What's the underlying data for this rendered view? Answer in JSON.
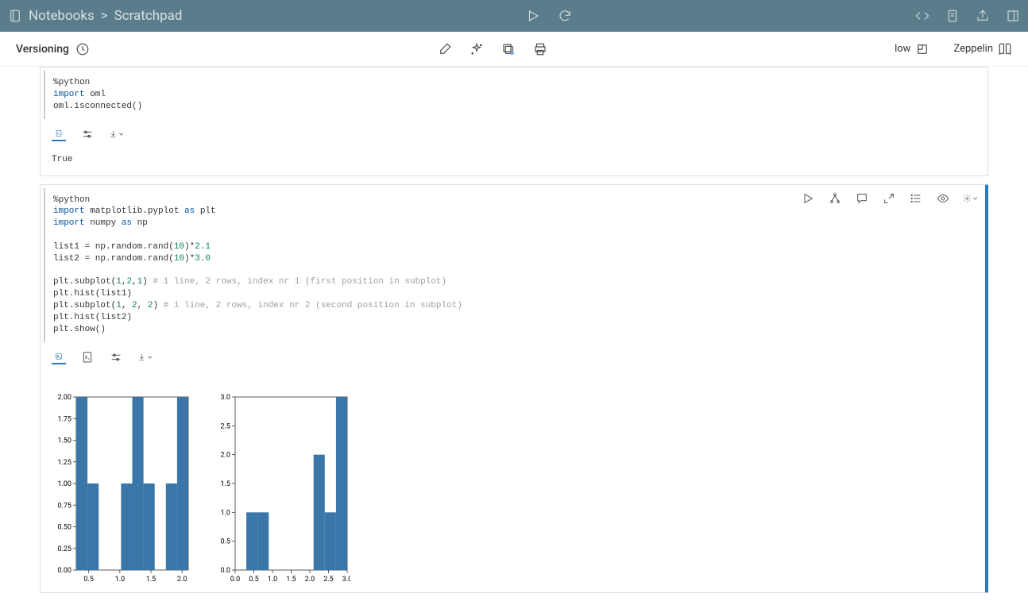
{
  "breadcrumb": {
    "icon": "notebook-icon",
    "part1": "Notebooks",
    "sep": ">",
    "part2": "Scratchpad"
  },
  "subbar": {
    "versioning": "Versioning",
    "low": "low",
    "zeppelin": "Zeppelin"
  },
  "cell1": {
    "code": "%python\nimport oml\noml.isconnected()",
    "code_tokens": [
      {
        "t": "id",
        "s": "%python\n"
      },
      {
        "t": "kw",
        "s": "import"
      },
      {
        "t": "id",
        "s": " oml\noml.isconnected()"
      }
    ],
    "output": "True"
  },
  "cell2": {
    "code_tokens": [
      {
        "t": "id",
        "s": "%python\n"
      },
      {
        "t": "kw",
        "s": "import"
      },
      {
        "t": "id",
        "s": " matplotlib.pyplot "
      },
      {
        "t": "kw",
        "s": "as"
      },
      {
        "t": "id",
        "s": " plt\n"
      },
      {
        "t": "kw",
        "s": "import"
      },
      {
        "t": "id",
        "s": " numpy "
      },
      {
        "t": "kw",
        "s": "as"
      },
      {
        "t": "id",
        "s": " np\n\n"
      },
      {
        "t": "id",
        "s": "list1 = np.random.rand("
      },
      {
        "t": "num",
        "s": "10"
      },
      {
        "t": "id",
        "s": ")*"
      },
      {
        "t": "num",
        "s": "2.1"
      },
      {
        "t": "id",
        "s": "\n"
      },
      {
        "t": "id",
        "s": "list2 = np.random.rand("
      },
      {
        "t": "num",
        "s": "10"
      },
      {
        "t": "id",
        "s": ")*"
      },
      {
        "t": "num",
        "s": "3.0"
      },
      {
        "t": "id",
        "s": "\n\n"
      },
      {
        "t": "id",
        "s": "plt.subplot("
      },
      {
        "t": "num",
        "s": "1"
      },
      {
        "t": "id",
        "s": ","
      },
      {
        "t": "num",
        "s": "2"
      },
      {
        "t": "id",
        "s": ","
      },
      {
        "t": "num",
        "s": "1"
      },
      {
        "t": "id",
        "s": ") "
      },
      {
        "t": "comment",
        "s": "# 1 line, 2 rows, index nr 1 (first position in subplot)"
      },
      {
        "t": "id",
        "s": "\n"
      },
      {
        "t": "id",
        "s": "plt.hist(list1)\n"
      },
      {
        "t": "id",
        "s": "plt.subplot("
      },
      {
        "t": "num",
        "s": "1"
      },
      {
        "t": "id",
        "s": ", "
      },
      {
        "t": "num",
        "s": "2"
      },
      {
        "t": "id",
        "s": ", "
      },
      {
        "t": "num",
        "s": "2"
      },
      {
        "t": "id",
        "s": ") "
      },
      {
        "t": "comment",
        "s": "# 1 line, 2 rows, index nr 2 (second position in subplot)"
      },
      {
        "t": "id",
        "s": "\n"
      },
      {
        "t": "id",
        "s": "plt.hist(list2)\nplt.show()"
      }
    ]
  },
  "chart_data": [
    {
      "type": "bar",
      "xlim": [
        0.3,
        2.1
      ],
      "ylim": [
        0,
        2.0
      ],
      "xticks": [
        0.5,
        1.0,
        1.5,
        2.0
      ],
      "yticks": [
        0.0,
        0.25,
        0.5,
        0.75,
        1.0,
        1.25,
        1.5,
        1.75,
        2.0
      ],
      "bin_edges": [
        0.3,
        0.48,
        0.66,
        0.84,
        1.02,
        1.2,
        1.38,
        1.56,
        1.74,
        1.92,
        2.1
      ],
      "values": [
        2,
        1,
        0,
        0,
        1,
        2,
        1,
        0,
        1,
        2
      ]
    },
    {
      "type": "bar",
      "xlim": [
        0.0,
        3.0
      ],
      "ylim": [
        0,
        3.0
      ],
      "xticks": [
        0.0,
        0.5,
        1.0,
        1.5,
        2.0,
        2.5,
        3.0
      ],
      "yticks": [
        0.0,
        0.5,
        1.0,
        1.5,
        2.0,
        2.5,
        3.0
      ],
      "bin_edges": [
        0.0,
        0.3,
        0.6,
        0.9,
        1.2,
        1.5,
        1.8,
        2.1,
        2.4,
        2.7,
        3.0
      ],
      "values": [
        0,
        1,
        1,
        0,
        0,
        0,
        0,
        2,
        1,
        3
      ]
    }
  ],
  "colors": {
    "bar": "#3a76a8",
    "axis": "#333",
    "active_border": "#2a7bbd",
    "topbar": "#5b7c8a"
  }
}
